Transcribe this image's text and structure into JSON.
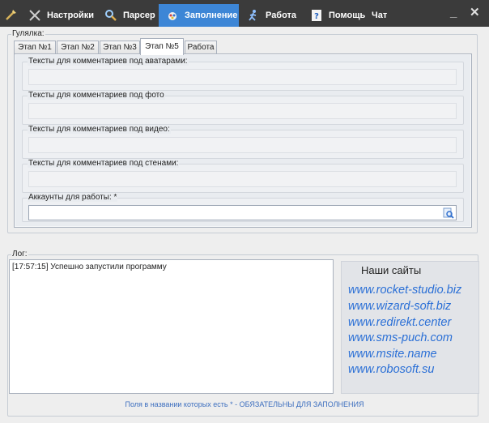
{
  "menu": {
    "settings": "Настройки",
    "parser": "Парсер",
    "filling": "Заполнение",
    "work": "Работа",
    "help": "Помощь",
    "chat": "Чат",
    "minimize": "_",
    "close": "✕"
  },
  "walker_group": {
    "label": "Гулялка:"
  },
  "tabs": [
    "Этап №1",
    "Этап №2",
    "Этап №3",
    "Этап №5",
    "Работа"
  ],
  "fields": {
    "avatars": "Тексты для комментариев под аватарами:",
    "photo": "Тексты для комментариев под фото",
    "video": "Тексты для комментариев под видео:",
    "walls": "Тексты для комментариев под стенами:",
    "accounts": "Аккаунты для работы: *"
  },
  "log": {
    "label": "Лог:",
    "lines": [
      "[17:57:15] Успешно запустили программу"
    ]
  },
  "sites": {
    "title": "Наши сайты",
    "links": [
      "www.rocket-studio.biz",
      "www.wizard-soft.biz",
      "www.redirekt.center",
      "www.sms-puch.com",
      "www.msite.name",
      "www.robosoft.su"
    ]
  },
  "footer": "Поля в названии которых есть * - ОБЯЗАТЕЛЬНЫ ДЛЯ ЗАПОЛНЕНИЯ",
  "colors": {
    "topbar": "#3b3b3b",
    "active_menu": "#3d86d6",
    "link": "#2a6fd6"
  }
}
